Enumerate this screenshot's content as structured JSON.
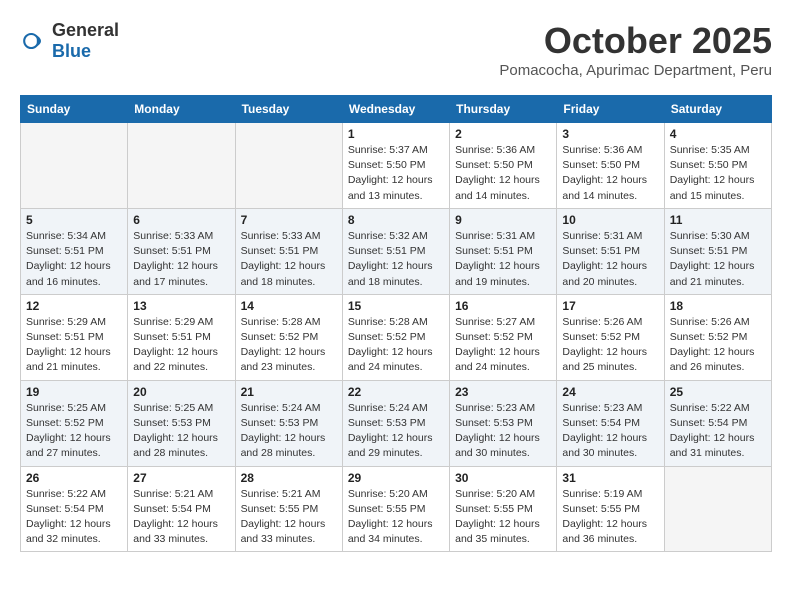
{
  "logo": {
    "general": "General",
    "blue": "Blue"
  },
  "title": "October 2025",
  "subtitle": "Pomacocha, Apurimac Department, Peru",
  "headers": [
    "Sunday",
    "Monday",
    "Tuesday",
    "Wednesday",
    "Thursday",
    "Friday",
    "Saturday"
  ],
  "weeks": [
    [
      {
        "day": "",
        "info": ""
      },
      {
        "day": "",
        "info": ""
      },
      {
        "day": "",
        "info": ""
      },
      {
        "day": "1",
        "info": "Sunrise: 5:37 AM\nSunset: 5:50 PM\nDaylight: 12 hours\nand 13 minutes."
      },
      {
        "day": "2",
        "info": "Sunrise: 5:36 AM\nSunset: 5:50 PM\nDaylight: 12 hours\nand 14 minutes."
      },
      {
        "day": "3",
        "info": "Sunrise: 5:36 AM\nSunset: 5:50 PM\nDaylight: 12 hours\nand 14 minutes."
      },
      {
        "day": "4",
        "info": "Sunrise: 5:35 AM\nSunset: 5:50 PM\nDaylight: 12 hours\nand 15 minutes."
      }
    ],
    [
      {
        "day": "5",
        "info": "Sunrise: 5:34 AM\nSunset: 5:51 PM\nDaylight: 12 hours\nand 16 minutes."
      },
      {
        "day": "6",
        "info": "Sunrise: 5:33 AM\nSunset: 5:51 PM\nDaylight: 12 hours\nand 17 minutes."
      },
      {
        "day": "7",
        "info": "Sunrise: 5:33 AM\nSunset: 5:51 PM\nDaylight: 12 hours\nand 18 minutes."
      },
      {
        "day": "8",
        "info": "Sunrise: 5:32 AM\nSunset: 5:51 PM\nDaylight: 12 hours\nand 18 minutes."
      },
      {
        "day": "9",
        "info": "Sunrise: 5:31 AM\nSunset: 5:51 PM\nDaylight: 12 hours\nand 19 minutes."
      },
      {
        "day": "10",
        "info": "Sunrise: 5:31 AM\nSunset: 5:51 PM\nDaylight: 12 hours\nand 20 minutes."
      },
      {
        "day": "11",
        "info": "Sunrise: 5:30 AM\nSunset: 5:51 PM\nDaylight: 12 hours\nand 21 minutes."
      }
    ],
    [
      {
        "day": "12",
        "info": "Sunrise: 5:29 AM\nSunset: 5:51 PM\nDaylight: 12 hours\nand 21 minutes."
      },
      {
        "day": "13",
        "info": "Sunrise: 5:29 AM\nSunset: 5:51 PM\nDaylight: 12 hours\nand 22 minutes."
      },
      {
        "day": "14",
        "info": "Sunrise: 5:28 AM\nSunset: 5:52 PM\nDaylight: 12 hours\nand 23 minutes."
      },
      {
        "day": "15",
        "info": "Sunrise: 5:28 AM\nSunset: 5:52 PM\nDaylight: 12 hours\nand 24 minutes."
      },
      {
        "day": "16",
        "info": "Sunrise: 5:27 AM\nSunset: 5:52 PM\nDaylight: 12 hours\nand 24 minutes."
      },
      {
        "day": "17",
        "info": "Sunrise: 5:26 AM\nSunset: 5:52 PM\nDaylight: 12 hours\nand 25 minutes."
      },
      {
        "day": "18",
        "info": "Sunrise: 5:26 AM\nSunset: 5:52 PM\nDaylight: 12 hours\nand 26 minutes."
      }
    ],
    [
      {
        "day": "19",
        "info": "Sunrise: 5:25 AM\nSunset: 5:52 PM\nDaylight: 12 hours\nand 27 minutes."
      },
      {
        "day": "20",
        "info": "Sunrise: 5:25 AM\nSunset: 5:53 PM\nDaylight: 12 hours\nand 28 minutes."
      },
      {
        "day": "21",
        "info": "Sunrise: 5:24 AM\nSunset: 5:53 PM\nDaylight: 12 hours\nand 28 minutes."
      },
      {
        "day": "22",
        "info": "Sunrise: 5:24 AM\nSunset: 5:53 PM\nDaylight: 12 hours\nand 29 minutes."
      },
      {
        "day": "23",
        "info": "Sunrise: 5:23 AM\nSunset: 5:53 PM\nDaylight: 12 hours\nand 30 minutes."
      },
      {
        "day": "24",
        "info": "Sunrise: 5:23 AM\nSunset: 5:54 PM\nDaylight: 12 hours\nand 30 minutes."
      },
      {
        "day": "25",
        "info": "Sunrise: 5:22 AM\nSunset: 5:54 PM\nDaylight: 12 hours\nand 31 minutes."
      }
    ],
    [
      {
        "day": "26",
        "info": "Sunrise: 5:22 AM\nSunset: 5:54 PM\nDaylight: 12 hours\nand 32 minutes."
      },
      {
        "day": "27",
        "info": "Sunrise: 5:21 AM\nSunset: 5:54 PM\nDaylight: 12 hours\nand 33 minutes."
      },
      {
        "day": "28",
        "info": "Sunrise: 5:21 AM\nSunset: 5:55 PM\nDaylight: 12 hours\nand 33 minutes."
      },
      {
        "day": "29",
        "info": "Sunrise: 5:20 AM\nSunset: 5:55 PM\nDaylight: 12 hours\nand 34 minutes."
      },
      {
        "day": "30",
        "info": "Sunrise: 5:20 AM\nSunset: 5:55 PM\nDaylight: 12 hours\nand 35 minutes."
      },
      {
        "day": "31",
        "info": "Sunrise: 5:19 AM\nSunset: 5:55 PM\nDaylight: 12 hours\nand 36 minutes."
      },
      {
        "day": "",
        "info": ""
      }
    ]
  ]
}
